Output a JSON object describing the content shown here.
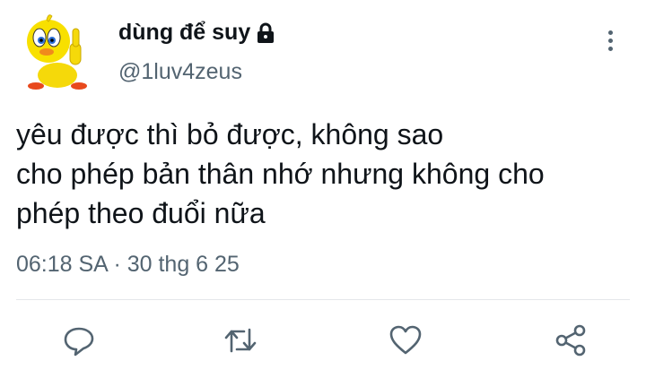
{
  "user": {
    "display_name": "dùng để suy",
    "handle": "@1luv4zeus",
    "protected_icon": "lock-icon",
    "avatar_icon": "tweety-bird-avatar"
  },
  "tweet": {
    "lines": [
      "yêu được thì bỏ được, không sao",
      "cho phép bản thân nhớ nhưng không cho",
      "phép theo đuổi nữa"
    ],
    "time": "06:18 SA",
    "separator": "·",
    "date": "30 thg 6 25"
  },
  "actions": {
    "reply_icon": "reply-icon",
    "retweet_icon": "retweet-icon",
    "like_icon": "heart-icon",
    "share_icon": "share-icon"
  },
  "colors": {
    "text": "#0f1419",
    "secondary": "#536471",
    "divider": "#e4e7ea"
  }
}
